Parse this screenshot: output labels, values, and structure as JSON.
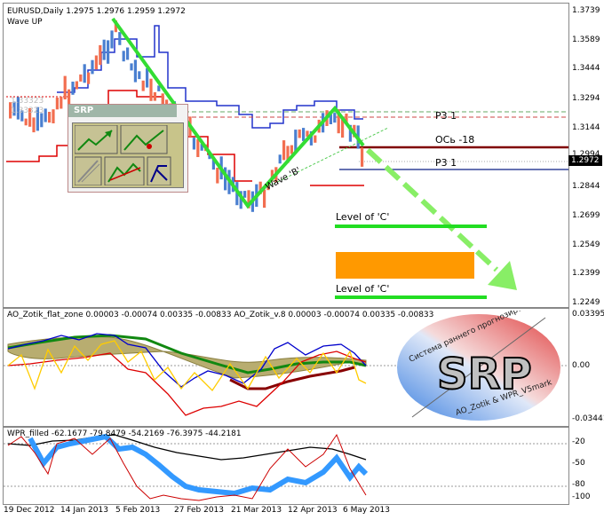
{
  "main": {
    "symbol_line": "EURUSD,Daily  1.2975 1.2976 1.2959 1.2972",
    "indicator": "Wave UP",
    "srp_panel_title": "SRP",
    "faint_price": "1.33323",
    "labels": {
      "p3_top": "P3 1",
      "axis": "ОСь -18",
      "p3_bottom": "P3 1",
      "wave_b": "Wave 'B'",
      "level_c_1": "Level of 'C'",
      "level_c_2": "Level of 'C'"
    },
    "price_axis": [
      "1.3739",
      "1.3589",
      "1.3444",
      "1.3294",
      "1.3144",
      "1.2994",
      "1.2844",
      "1.2699",
      "1.2549",
      "1.2399",
      "1.2249"
    ],
    "current_price": "1.2972",
    "colors": {
      "bull": "#4a7fd0",
      "bear": "#f26e50",
      "wave": "#33dd33",
      "dark_red": "#800000",
      "orange": "#ff9900"
    }
  },
  "osc": {
    "title": "AO_Zotik_flat_zone 0.00003 -0.00074 0.00335 -0.00833  AO_Zotik_v.8 0.00003 -0.00074 0.00335 -0.00833",
    "axis": [
      "0.03395",
      "0.00",
      "-0.03441"
    ]
  },
  "logo": {
    "big_text": "SRP",
    "arc_top": "Система раннего прогнозирования",
    "arc_bottom": "AO_Zotik & WPR_V5mark"
  },
  "wpr": {
    "title": "WPR_filled -62.1677 -79.8479 -54.2169 -76.3975 -44.2181",
    "axis": [
      "-20",
      "-50",
      "-80",
      "-100"
    ]
  },
  "xaxis": [
    "19 Dec 2012",
    "14 Jan 2013",
    "5 Feb 2013",
    "27 Feb 2013",
    "21 Mar 2013",
    "12 Apr 2013",
    "6 May 2013"
  ]
}
